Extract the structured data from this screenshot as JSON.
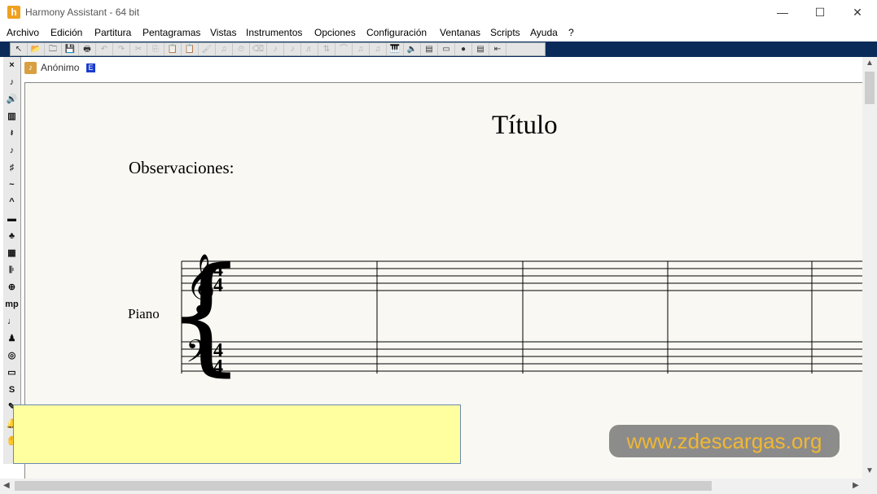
{
  "window": {
    "title": "Harmony Assistant - 64 bit",
    "app_icon": "h",
    "controls": [
      "—",
      "☐",
      "✕"
    ]
  },
  "menu": [
    "Archivo",
    "Edición",
    "Partitura",
    "Pentagramas",
    "Vistas",
    "Instrumentos",
    "Opciones",
    "Configuración",
    "Ventanas",
    "Scripts",
    "Ayuda",
    "?"
  ],
  "toolbar": {
    "icons": [
      "pointer-icon",
      "open-icon",
      "open-folder-icon",
      "save-icon",
      "print-icon",
      "undo-icon",
      "redo-icon",
      "cut-icon",
      "copy-icon",
      "paste-icon",
      "paste-special-icon",
      "brush-icon",
      "notes-icon",
      "metronome-icon",
      "eraser-icon",
      "note-icon",
      "note-icon",
      "beam-icon",
      "transpose-icon",
      "tie-icon",
      "note-group-icon",
      "note-group-icon",
      "piano-icon",
      "speaker-icon",
      "score-view-icon",
      "track-icon",
      "record-icon",
      "score-icon",
      "arrow-left-icon"
    ],
    "glyphs": [
      "↖",
      "📂",
      "🗀",
      "💾",
      "🖶",
      "↶",
      "↷",
      "✂",
      "⎘",
      "📋",
      "📋",
      "🖌",
      "♫",
      "⏲",
      "⌫",
      "♪",
      "♪",
      "♬",
      "⇅",
      "⌒",
      "♫",
      "♫",
      "🎹",
      "🔈",
      "▤",
      "▭",
      "●",
      "▤",
      "⇤"
    ],
    "disabled": [
      5,
      6,
      7,
      8,
      9,
      10,
      11,
      12,
      13,
      14,
      15,
      16,
      17,
      18,
      19,
      20,
      21,
      22,
      23
    ]
  },
  "palette": {
    "icons": [
      "close-icon",
      "select-tool-icon",
      "speaker-icon",
      "keyboard-icon",
      "rest-icon",
      "note-icon",
      "sharp-icon",
      "trill-icon",
      "accent-icon",
      "measure-icon",
      "chord-icon",
      "chord-diagram-icon",
      "repeat-icon",
      "coda-icon",
      "dynamics-icon",
      "tempo-icon",
      "instruments-icon",
      "metronome-icon",
      "bar-icon",
      "text-icon",
      "pencil-icon",
      "bell-icon",
      "hand-icon"
    ],
    "glyphs": [
      "×",
      "♪",
      "🔊",
      "▥",
      "𝄽",
      "♪",
      "♯",
      "~",
      "^",
      "▬",
      "♣",
      "▦",
      "𝄆",
      "⊕",
      "mp",
      "♩",
      "♟",
      "◎",
      "▭",
      "S",
      "✎",
      "🔔",
      "✋"
    ]
  },
  "document": {
    "tab_label": "Anónimo",
    "tab_badge": "E"
  },
  "score": {
    "title": "Título",
    "observations": "Observaciones:",
    "instrument": "Piano",
    "time_signature": [
      "4",
      "4"
    ]
  },
  "watermark": "www.zdescargas.org",
  "colors": {
    "toolbar_bg": "#0a2a5a",
    "page_bg": "#f9f8f2",
    "popup_bg": "#ffffa0",
    "watermark_text": "#f0b020"
  }
}
